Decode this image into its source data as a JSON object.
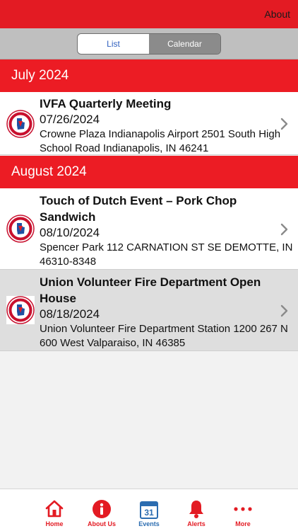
{
  "header": {
    "about_label": "About"
  },
  "segment": {
    "list_label": "List",
    "calendar_label": "Calendar"
  },
  "sections": [
    {
      "title": "July 2024"
    },
    {
      "title": "August 2024"
    }
  ],
  "events": [
    {
      "title": "IVFA Quarterly Meeting",
      "date": "07/26/2024",
      "location": "Crowne Plaza Indianapolis Airport 2501 South High School Road Indianapolis, IN 46241"
    },
    {
      "title": "Touch of Dutch Event – Pork Chop Sandwich",
      "date": "08/10/2024",
      "location": "Spencer Park 112 CARNATION ST SE DEMOTTE, IN 46310-8348"
    },
    {
      "title": "Union Volunteer Fire Department Open House",
      "date": "08/18/2024",
      "location": "Union Volunteer Fire Department Station 1200 267 N 600 West Valparaiso, IN 46385",
      "selected": true
    }
  ],
  "tabbar": {
    "home": "Home",
    "about_us": "About Us",
    "events": "Events",
    "calendar_day": "31",
    "alerts": "Alerts",
    "more": "More"
  },
  "colors": {
    "brand_red": "#e31b23",
    "active_tab_blue": "#2b6cb0"
  }
}
